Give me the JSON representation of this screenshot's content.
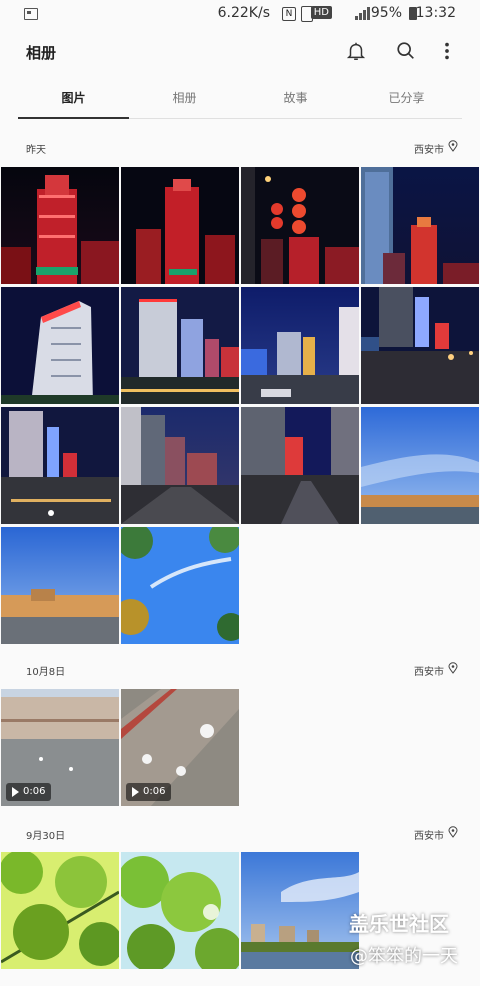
{
  "status_bar": {
    "speed": "6.22K/s",
    "hd": "HD",
    "battery": "95%",
    "time": "13:32"
  },
  "header": {
    "title": "相册",
    "icons": [
      "bell-icon",
      "search-icon",
      "more-icon"
    ]
  },
  "tabs": [
    {
      "label": "图片",
      "active": true
    },
    {
      "label": "相册",
      "active": false
    },
    {
      "label": "故事",
      "active": false
    },
    {
      "label": "已分享",
      "active": false
    }
  ],
  "sections": [
    {
      "date": "昨天",
      "location": "西安市",
      "count": 14
    },
    {
      "date": "10月8日",
      "location": "西安市",
      "count": 2
    },
    {
      "date": "9月30日",
      "location": "西安市",
      "count": 3
    }
  ],
  "videos": [
    {
      "duration": "0:06"
    },
    {
      "duration": "0:06"
    }
  ],
  "watermark": {
    "brand": "盖乐世社区",
    "user": "@笨笨的一天"
  }
}
